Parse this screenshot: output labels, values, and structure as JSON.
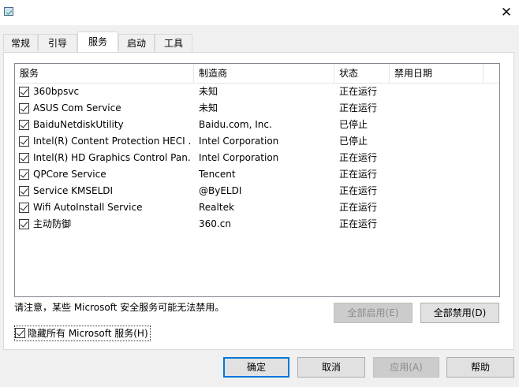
{
  "window": {
    "close_glyph": "✕"
  },
  "tabs": [
    {
      "label": "常规"
    },
    {
      "label": "引导"
    },
    {
      "label": "服务"
    },
    {
      "label": "启动"
    },
    {
      "label": "工具"
    }
  ],
  "columns": {
    "service": "服务",
    "manufacturer": "制造商",
    "status": "状态",
    "disabled_date": "禁用日期"
  },
  "services": [
    {
      "checked": true,
      "name": "360bpsvc",
      "manufacturer": "未知",
      "status": "正在运行"
    },
    {
      "checked": true,
      "name": "ASUS Com Service",
      "manufacturer": "未知",
      "status": "正在运行"
    },
    {
      "checked": true,
      "name": "BaiduNetdiskUtility",
      "manufacturer": "Baidu.com, Inc.",
      "status": "已停止"
    },
    {
      "checked": true,
      "name": "Intel(R) Content Protection HECI ...",
      "manufacturer": "Intel Corporation",
      "status": "已停止"
    },
    {
      "checked": true,
      "name": "Intel(R) HD Graphics Control Pan...",
      "manufacturer": "Intel Corporation",
      "status": "正在运行"
    },
    {
      "checked": true,
      "name": "QPCore Service",
      "manufacturer": "Tencent",
      "status": "正在运行"
    },
    {
      "checked": true,
      "name": "Service KMSELDI",
      "manufacturer": "@ByELDI",
      "status": "正在运行"
    },
    {
      "checked": true,
      "name": "Wifi AutoInstall Service",
      "manufacturer": "Realtek",
      "status": "正在运行"
    },
    {
      "checked": true,
      "name": "主动防御",
      "manufacturer": "360.cn",
      "status": "正在运行"
    }
  ],
  "note": "请注意，某些 Microsoft 安全服务可能无法禁用。",
  "buttons": {
    "enable_all": "全部启用(E)",
    "disable_all": "全部禁用(D)",
    "ok": "确定",
    "cancel": "取消",
    "apply": "应用(A)",
    "help": "帮助"
  },
  "hide_ms": {
    "checked": true,
    "label": "隐藏所有 Microsoft 服务(H)"
  }
}
